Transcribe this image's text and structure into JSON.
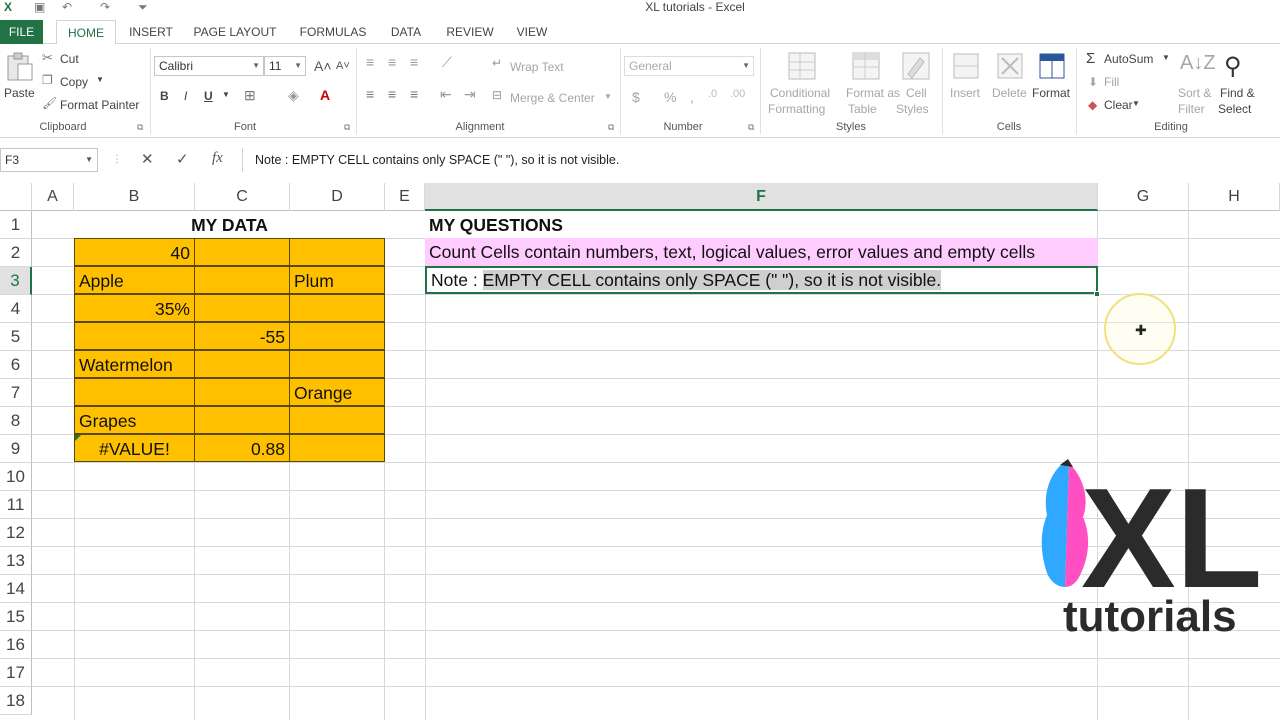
{
  "window": {
    "title": "XL tutorials - Excel"
  },
  "tabs": [
    "FILE",
    "HOME",
    "INSERT",
    "PAGE LAYOUT",
    "FORMULAS",
    "DATA",
    "REVIEW",
    "VIEW"
  ],
  "ribbon": {
    "clipboard": {
      "label": "Clipboard",
      "paste": "Paste",
      "cut": "Cut",
      "copy": "Copy",
      "format_painter": "Format Painter"
    },
    "font": {
      "label": "Font",
      "name": "Calibri",
      "size": "11",
      "bold": "B",
      "italic": "I",
      "underline": "U"
    },
    "alignment": {
      "label": "Alignment",
      "wrap_text": "Wrap Text",
      "merge_center": "Merge & Center"
    },
    "number": {
      "label": "Number",
      "format": "General",
      "currency": "$",
      "percent": "%",
      "comma": ","
    },
    "styles": {
      "label": "Styles",
      "conditional_1": "Conditional",
      "conditional_2": "Formatting",
      "format_as_1": "Format as",
      "format_as_2": "Table",
      "cell_styles_1": "Cell",
      "cell_styles_2": "Styles"
    },
    "cells": {
      "label": "Cells",
      "insert": "Insert",
      "delete": "Delete",
      "format": "Format"
    },
    "editing": {
      "label": "Editing",
      "autosum": "AutoSum",
      "fill": "Fill",
      "clear": "Clear",
      "sort_1": "Sort &",
      "sort_2": "Filter",
      "find_1": "Find &",
      "find_2": "Select"
    }
  },
  "formula_bar": {
    "name_box": "F3",
    "cancel": "✕",
    "enter": "✓",
    "fx": "fx",
    "content": "Note : EMPTY CELL contains only SPACE (\" \"), so it is not visible."
  },
  "columns": [
    "A",
    "B",
    "C",
    "D",
    "E",
    "F",
    "G",
    "H"
  ],
  "rows": [
    "1",
    "2",
    "3",
    "4",
    "5",
    "6",
    "7",
    "8",
    "9",
    "10",
    "11",
    "12",
    "13",
    "14",
    "15",
    "16",
    "17",
    "18"
  ],
  "cells": {
    "B1": "MY DATA",
    "B2": "40",
    "B3": "Apple",
    "D3": "Plum",
    "B4": "35%",
    "C5": "-55",
    "B6": "Watermelon",
    "D7": "Orange",
    "B8": "Grapes",
    "B9": "#VALUE!",
    "C9": "0.88",
    "F1": "MY QUESTIONS",
    "F2": "Count Cells contain numbers, text, logical values, error values and empty cells",
    "F3_prefix": "Note : ",
    "F3_selected": "EMPTY CELL contains only SPACE (\" \"), so it is not visible."
  },
  "logo": {
    "main": "XL",
    "sub": "tutorials"
  },
  "colors": {
    "excel_green": "#217346",
    "data_fill": "#ffc000",
    "question_fill": "#ffccff"
  }
}
